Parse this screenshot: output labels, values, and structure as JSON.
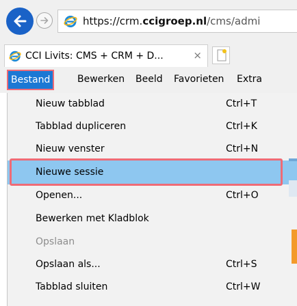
{
  "address_bar": {
    "url_scheme": "https://",
    "url_sub": "crm.",
    "url_domain": "ccigroep.nl",
    "url_path": "/cms/admi"
  },
  "tab": {
    "title": "CCI Livits: CMS + CRM + D...",
    "close": "×"
  },
  "menubar": {
    "items": [
      "Bestand",
      "Bewerken",
      "Beeld",
      "Favorieten",
      "Extra"
    ]
  },
  "dropdown": {
    "items": [
      {
        "label": "Nieuw tabblad",
        "shortcut": "Ctrl+T"
      },
      {
        "label": "Tabblad dupliceren",
        "shortcut": "Ctrl+K"
      },
      {
        "label": "Nieuw venster",
        "shortcut": "Ctrl+N"
      },
      {
        "label": "Nieuwe sessie",
        "shortcut": ""
      },
      {
        "label": "Openen...",
        "shortcut": "Ctrl+O"
      },
      {
        "label": "Bewerken met Kladblok",
        "shortcut": ""
      },
      {
        "label": "Opslaan",
        "shortcut": ""
      },
      {
        "label": "Opslaan als...",
        "shortcut": "Ctrl+S"
      },
      {
        "label": "Tabblad sluiten",
        "shortcut": "Ctrl+W"
      }
    ],
    "highlighted": "Nieuwe sessie",
    "disabled": "Opslaan"
  },
  "colors": {
    "back_button": "#1a62c7",
    "menu_active": "#1c78d4",
    "highlight_outline": "#ef6b76",
    "hover_row": "#8ec7f0"
  },
  "icons": {
    "back": "arrow-left-icon",
    "forward": "arrow-right-icon",
    "browser": "internet-explorer-icon",
    "new_tab": "new-tab-icon"
  }
}
